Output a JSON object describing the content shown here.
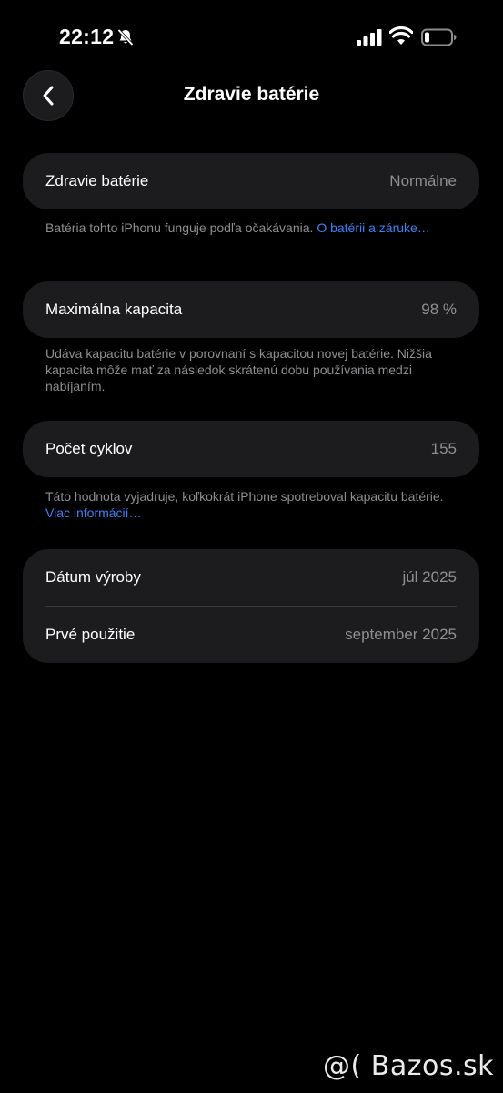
{
  "status_bar": {
    "time": "22:12"
  },
  "nav": {
    "title": "Zdravie batérie"
  },
  "sections": {
    "health": {
      "label": "Zdravie batérie",
      "value": "Normálne",
      "footnote": "Batéria tohto iPhonu funguje podľa očakávania.",
      "link": "O batérii a záruke…"
    },
    "capacity": {
      "label": "Maximálna kapacita",
      "value": "98 %",
      "footnote": "Udáva kapacitu batérie v porovnaní s kapacitou novej batérie. Nižšia kapacita môže mať za následok skrátenú dobu používania medzi nabíjaním."
    },
    "cycles": {
      "label": "Počet cyklov",
      "value": "155",
      "footnote": "Táto hodnota vyjadruje, koľkokrát iPhone spotreboval kapacitu batérie.",
      "link": "Viac informácií…"
    },
    "dates": {
      "manufacture_label": "Dátum výroby",
      "manufacture_value": "júl 2025",
      "first_use_label": "Prvé použitie",
      "first_use_value": "september 2025"
    }
  },
  "watermark": "@( Bazos.sk",
  "colors": {
    "background": "#000000",
    "card": "#1c1c1e",
    "secondary_text": "#8e8e93",
    "link": "#3a82f7"
  }
}
